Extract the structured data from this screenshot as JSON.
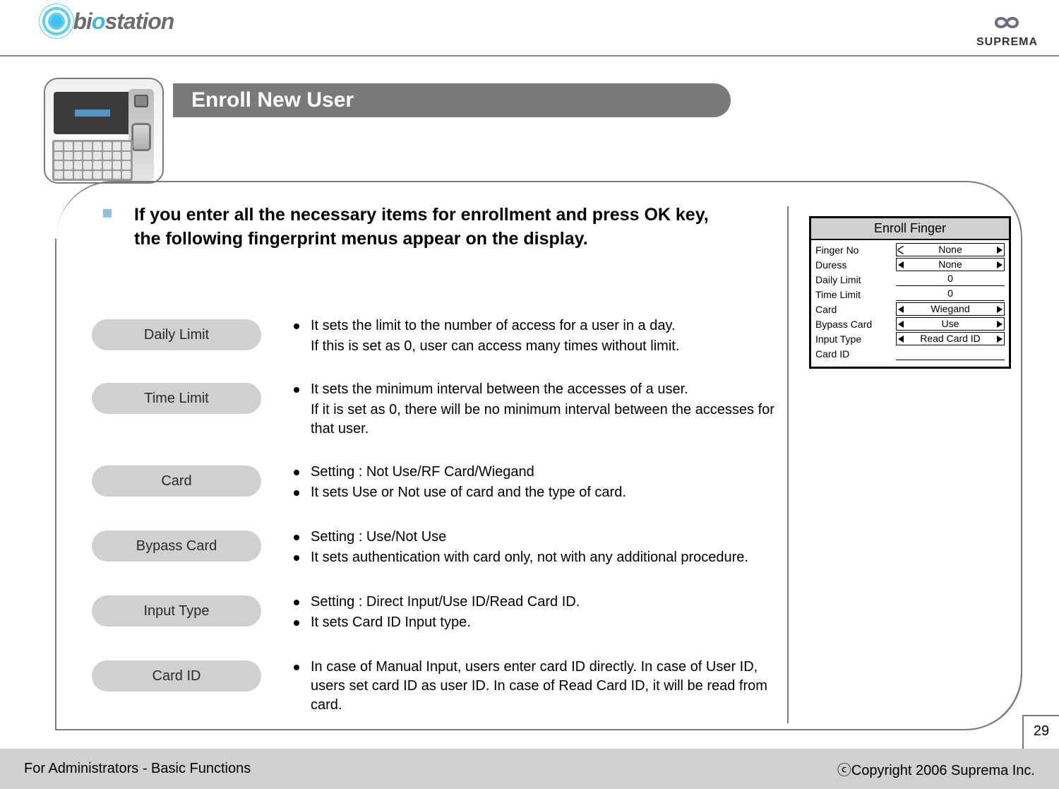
{
  "header": {
    "left_logo_text_pre": "bi",
    "left_logo_text_mid": "o",
    "left_logo_text_post": "station",
    "right_brand": "SUPREMA"
  },
  "title": "Enroll New User",
  "intro": "If you enter all the necessary items for enrollment and press OK key, the following fingerprint menus appear on the display.",
  "panel": {
    "title": "Enroll Finger",
    "rows": [
      {
        "label": "Finger No",
        "value": "None",
        "left_hollow": true
      },
      {
        "label": "Duress",
        "value": "None"
      },
      {
        "label": "Daily Limit",
        "value": "0",
        "style": "underline"
      },
      {
        "label": "Time Limit",
        "value": "0",
        "style": "underline"
      },
      {
        "label": "Card",
        "value": "Wiegand"
      },
      {
        "label": "Bypass Card",
        "value": "Use"
      },
      {
        "label": "Input Type",
        "value": "Read Card ID"
      },
      {
        "label": "Card ID",
        "value": "",
        "style": "underline"
      }
    ]
  },
  "options": [
    {
      "name": "Daily Limit",
      "bullets": [
        "It sets the limit to the number of access for a user in a day."
      ],
      "sub": "If this is set as 0, user can access many times without limit."
    },
    {
      "name": "Time Limit",
      "bullets": [
        "It sets the minimum interval between the accesses of a user."
      ],
      "sub": "If it is set as 0, there will be no minimum interval between the accesses for that user."
    },
    {
      "name": "Card",
      "bullets": [
        "Setting : Not Use/RF Card/Wiegand",
        "It sets Use or Not use of card and the type of card."
      ]
    },
    {
      "name": "Bypass Card",
      "bullets": [
        "Setting : Use/Not Use",
        "It sets authentication with card only, not with any additional procedure."
      ]
    },
    {
      "name": "Input Type",
      "bullets": [
        "Setting : Direct Input/Use ID/Read Card ID.",
        "It sets Card ID Input type."
      ]
    },
    {
      "name": "Card ID",
      "bullets": [
        "In case of Manual Input, users enter card ID directly. In case of User ID, users set card ID as user ID. In case of Read Card ID, it will be read from card."
      ]
    }
  ],
  "page_number": "29",
  "footer": {
    "left": "For Administrators - Basic Functions",
    "right": "ⓒCopyright 2006 Suprema Inc."
  }
}
